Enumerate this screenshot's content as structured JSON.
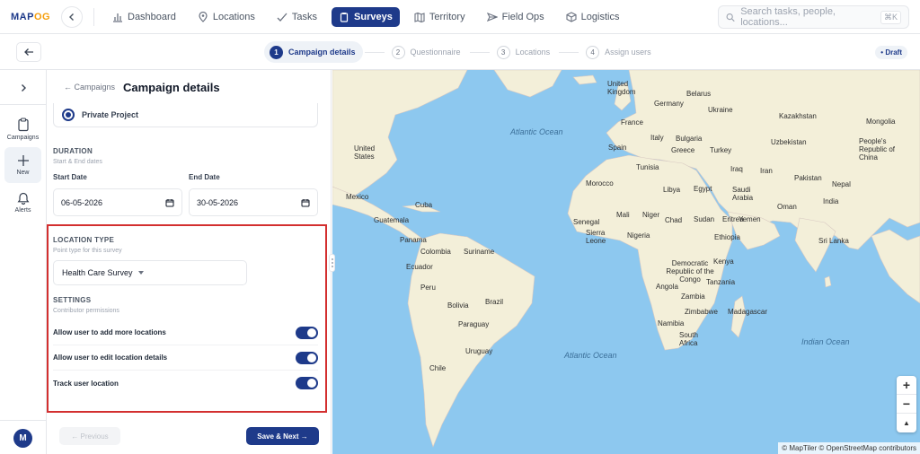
{
  "app": {
    "logo_text": "MAP",
    "logo_accent": "OG"
  },
  "nav": {
    "items": [
      {
        "label": "Dashboard",
        "icon": "bar-chart-icon",
        "active": false
      },
      {
        "label": "Locations",
        "icon": "pin-icon",
        "active": false
      },
      {
        "label": "Tasks",
        "icon": "check-icon",
        "active": false
      },
      {
        "label": "Surveys",
        "icon": "clipboard-icon",
        "active": true
      },
      {
        "label": "Territory",
        "icon": "map-icon",
        "active": false
      },
      {
        "label": "Field Ops",
        "icon": "send-icon",
        "active": false
      },
      {
        "label": "Logistics",
        "icon": "box-icon",
        "active": false
      }
    ],
    "search_placeholder": "Search tasks, people, locations...",
    "search_shortcut": "⌘K"
  },
  "stepper": {
    "steps": [
      {
        "num": "1",
        "label": "Campaign details",
        "active": true
      },
      {
        "num": "2",
        "label": "Questionnaire",
        "active": false
      },
      {
        "num": "3",
        "label": "Locations",
        "active": false
      },
      {
        "num": "4",
        "label": "Assign users",
        "active": false
      }
    ],
    "status": "• Draft"
  },
  "rail": {
    "items": [
      {
        "label": "Campaigns",
        "icon": "clipboard-icon"
      },
      {
        "label": "New",
        "icon": "plus-icon"
      },
      {
        "label": "Alerts",
        "icon": "bell-icon"
      }
    ],
    "avatar_initial": "M"
  },
  "panel": {
    "back_link": "← Campaigns",
    "title": "Campaign details",
    "project_option": "Private Project",
    "duration": {
      "title": "DURATION",
      "subtitle": "Start & End dates",
      "start_label": "Start Date",
      "start_value": "06-05-2026",
      "end_label": "End Date",
      "end_value": "30-05-2026"
    },
    "location_type": {
      "title": "LOCATION TYPE",
      "subtitle": "Point type for this survey",
      "selected": "Health Care Survey"
    },
    "settings": {
      "title": "SETTINGS",
      "subtitle": "Contributor permissions",
      "toggles": [
        {
          "label": "Allow user to add more locations",
          "on": true
        },
        {
          "label": "Allow user to edit location details",
          "on": true
        },
        {
          "label": "Track user location",
          "on": true
        }
      ]
    },
    "prev_label": "← Previous",
    "next_label": "Save & Next →"
  },
  "map": {
    "labels": {
      "united_kingdom": "United Kingdom",
      "belarus": "Belarus",
      "ukraine": "Ukraine",
      "germany": "Germany",
      "france": "France",
      "italy": "Italy",
      "bulgaria": "Bulgaria",
      "spain": "Spain",
      "greece": "Greece",
      "turkey": "Turkey",
      "kazakhstan": "Kazakhstan",
      "mongolia": "Mongolia",
      "uzbekistan": "Uzbekistan",
      "china": "People's Republic of China",
      "iran": "Iran",
      "iraq": "Iraq",
      "tunisia": "Tunisia",
      "morocco": "Morocco",
      "libya": "Libya",
      "egypt": "Egypt",
      "saudi": "Saudi Arabia",
      "pakistan": "Pakistan",
      "nepal": "Nepal",
      "india": "India",
      "oman": "Oman",
      "yemen": "Yemen",
      "mali": "Mali",
      "niger": "Niger",
      "chad": "Chad",
      "sudan": "Sudan",
      "eritrea": "Eritrea",
      "senegal": "Senegal",
      "sierra": "Sierra Leone",
      "nigeria": "Nigeria",
      "ethiopia": "Ethiopia",
      "kenya": "Kenya",
      "drc": "Democratic Republic of the Congo",
      "tanzania": "Tanzania",
      "angola": "Angola",
      "zambia": "Zambia",
      "zimbabwe": "Zimbabwe",
      "madagascar": "Madagascar",
      "namibia": "Namibia",
      "south_africa": "South Africa",
      "sri_lanka": "Sri Lanka",
      "united_states": "United States",
      "mexico": "Mexico",
      "cuba": "Cuba",
      "guatemala": "Guatemala",
      "panama": "Panama",
      "colombia": "Colombia",
      "suriname": "Suriname",
      "ecuador": "Ecuador",
      "peru": "Peru",
      "brazil": "Brazil",
      "bolivia": "Bolivia",
      "paraguay": "Paraguay",
      "uruguay": "Uruguay",
      "chile": "Chile",
      "atlantic_n": "Atlantic Ocean",
      "atlantic_s": "Atlantic Ocean",
      "indian": "Indian Ocean"
    },
    "zoom_in": "+",
    "zoom_out": "−",
    "compass": "▲",
    "attribution": "© MapTiler © OpenStreetMap contributors"
  }
}
